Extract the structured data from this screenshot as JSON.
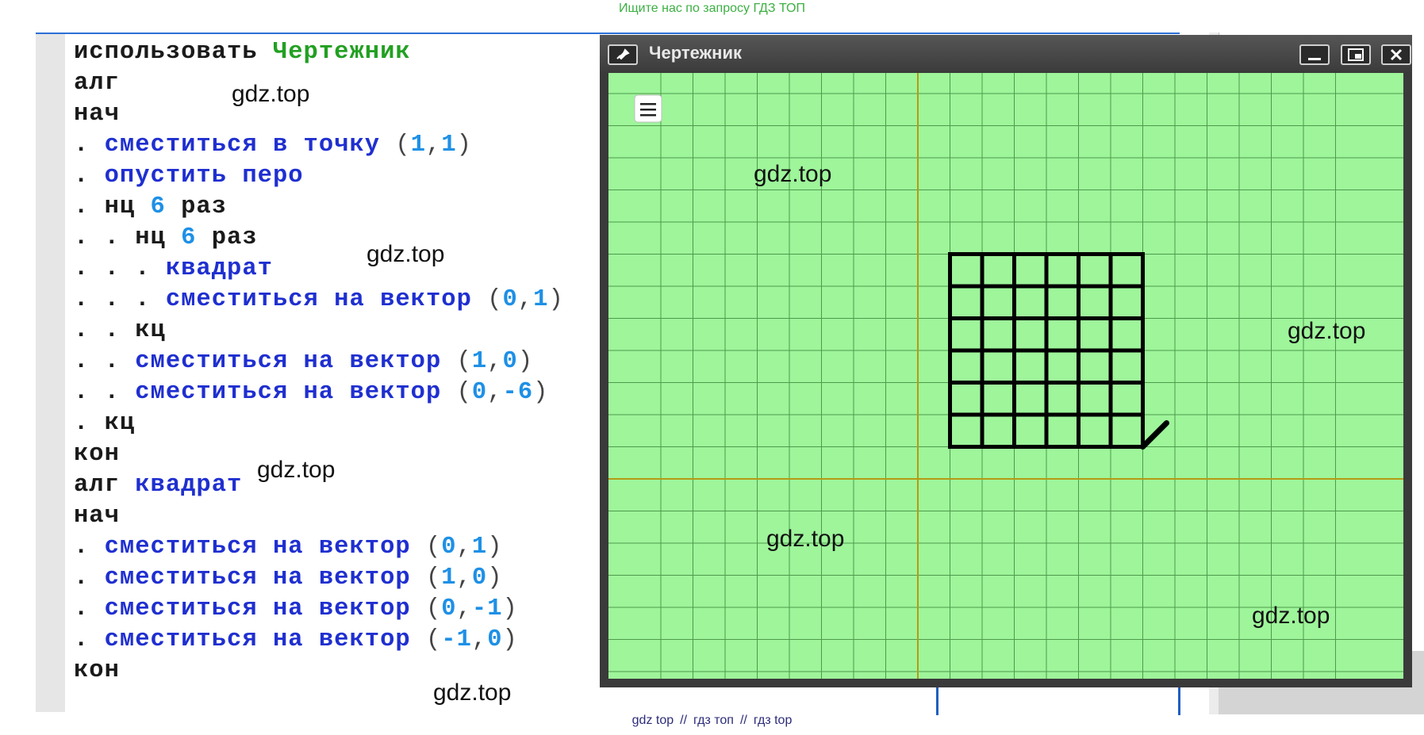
{
  "top_banner": "Ищите нас по запросу ГДЗ ТОП",
  "bottom_banner": [
    "gdz top",
    "//",
    "гдз топ",
    "//",
    "гдз top"
  ],
  "watermark": "gdz.top",
  "code_lines": [
    [
      {
        "t": "использовать ",
        "c": "kw"
      },
      {
        "t": "Чертежник",
        "c": "mod"
      }
    ],
    [
      {
        "t": "алг",
        "c": "kw"
      }
    ],
    [
      {
        "t": "нач",
        "c": "kw"
      }
    ],
    [
      {
        "t": ". ",
        "c": "kw"
      },
      {
        "t": "сместиться в точку ",
        "c": "fn"
      },
      {
        "t": "(",
        "c": "pn"
      },
      {
        "t": "1",
        "c": "num"
      },
      {
        "t": ",",
        "c": "pn"
      },
      {
        "t": "1",
        "c": "num"
      },
      {
        "t": ")",
        "c": "pn"
      }
    ],
    [
      {
        "t": ". ",
        "c": "kw"
      },
      {
        "t": "опустить перо",
        "c": "fn"
      }
    ],
    [
      {
        "t": ". нц ",
        "c": "kw"
      },
      {
        "t": "6",
        "c": "num"
      },
      {
        "t": " раз",
        "c": "kw"
      }
    ],
    [
      {
        "t": ". . нц ",
        "c": "kw"
      },
      {
        "t": "6",
        "c": "num"
      },
      {
        "t": " раз",
        "c": "kw"
      }
    ],
    [
      {
        "t": ". . . ",
        "c": "kw"
      },
      {
        "t": "квадрат",
        "c": "fn"
      }
    ],
    [
      {
        "t": ". . . ",
        "c": "kw"
      },
      {
        "t": "сместиться на вектор ",
        "c": "fn"
      },
      {
        "t": "(",
        "c": "pn"
      },
      {
        "t": "0",
        "c": "num"
      },
      {
        "t": ",",
        "c": "pn"
      },
      {
        "t": "1",
        "c": "num"
      },
      {
        "t": ")",
        "c": "pn"
      }
    ],
    [
      {
        "t": ". . кц",
        "c": "kw"
      }
    ],
    [
      {
        "t": ". . ",
        "c": "kw"
      },
      {
        "t": "сместиться на вектор ",
        "c": "fn"
      },
      {
        "t": "(",
        "c": "pn"
      },
      {
        "t": "1",
        "c": "num"
      },
      {
        "t": ",",
        "c": "pn"
      },
      {
        "t": "0",
        "c": "num"
      },
      {
        "t": ")",
        "c": "pn"
      }
    ],
    [
      {
        "t": ". . ",
        "c": "kw"
      },
      {
        "t": "сместиться на вектор ",
        "c": "fn"
      },
      {
        "t": "(",
        "c": "pn"
      },
      {
        "t": "0",
        "c": "num"
      },
      {
        "t": ",",
        "c": "pn"
      },
      {
        "t": "-6",
        "c": "num"
      },
      {
        "t": ")",
        "c": "pn"
      }
    ],
    [
      {
        "t": ". кц",
        "c": "kw"
      }
    ],
    [
      {
        "t": "кон",
        "c": "kw"
      }
    ],
    [
      {
        "t": "алг ",
        "c": "kw"
      },
      {
        "t": "квадрат",
        "c": "fn"
      }
    ],
    [
      {
        "t": "нач",
        "c": "kw"
      }
    ],
    [
      {
        "t": ". ",
        "c": "kw"
      },
      {
        "t": "сместиться на вектор ",
        "c": "fn"
      },
      {
        "t": "(",
        "c": "pn"
      },
      {
        "t": "0",
        "c": "num"
      },
      {
        "t": ",",
        "c": "pn"
      },
      {
        "t": "1",
        "c": "num"
      },
      {
        "t": ")",
        "c": "pn"
      }
    ],
    [
      {
        "t": ". ",
        "c": "kw"
      },
      {
        "t": "сместиться на вектор ",
        "c": "fn"
      },
      {
        "t": "(",
        "c": "pn"
      },
      {
        "t": "1",
        "c": "num"
      },
      {
        "t": ",",
        "c": "pn"
      },
      {
        "t": "0",
        "c": "num"
      },
      {
        "t": ")",
        "c": "pn"
      }
    ],
    [
      {
        "t": ". ",
        "c": "kw"
      },
      {
        "t": "сместиться на вектор ",
        "c": "fn"
      },
      {
        "t": "(",
        "c": "pn"
      },
      {
        "t": "0",
        "c": "num"
      },
      {
        "t": ",",
        "c": "pn"
      },
      {
        "t": "-1",
        "c": "num"
      },
      {
        "t": ")",
        "c": "pn"
      }
    ],
    [
      {
        "t": ". ",
        "c": "kw"
      },
      {
        "t": "сместиться на вектор ",
        "c": "fn"
      },
      {
        "t": "(",
        "c": "pn"
      },
      {
        "t": "-1",
        "c": "num"
      },
      {
        "t": ",",
        "c": "pn"
      },
      {
        "t": "0",
        "c": "num"
      },
      {
        "t": ")",
        "c": "pn"
      }
    ],
    [
      {
        "t": "кон",
        "c": "kw"
      }
    ]
  ],
  "window": {
    "title": "Чертежник",
    "icons": [
      "pin-icon",
      "minimize-icon",
      "restore-icon",
      "close-icon"
    ]
  },
  "drawing": {
    "x_range": [
      -8,
      13
    ],
    "y_range": [
      -6,
      13
    ],
    "origin": [
      0,
      0
    ],
    "grid_step": 1,
    "grid_nodes": {
      "x_from": 1,
      "x_to": 7,
      "y_from": 1,
      "y_to": 7
    },
    "pen_position": [
      7,
      1
    ],
    "colors": {
      "field": "#9ef59a",
      "grid": "#4f9a4c",
      "axes": "#b59a14",
      "pen": "#000000"
    }
  }
}
